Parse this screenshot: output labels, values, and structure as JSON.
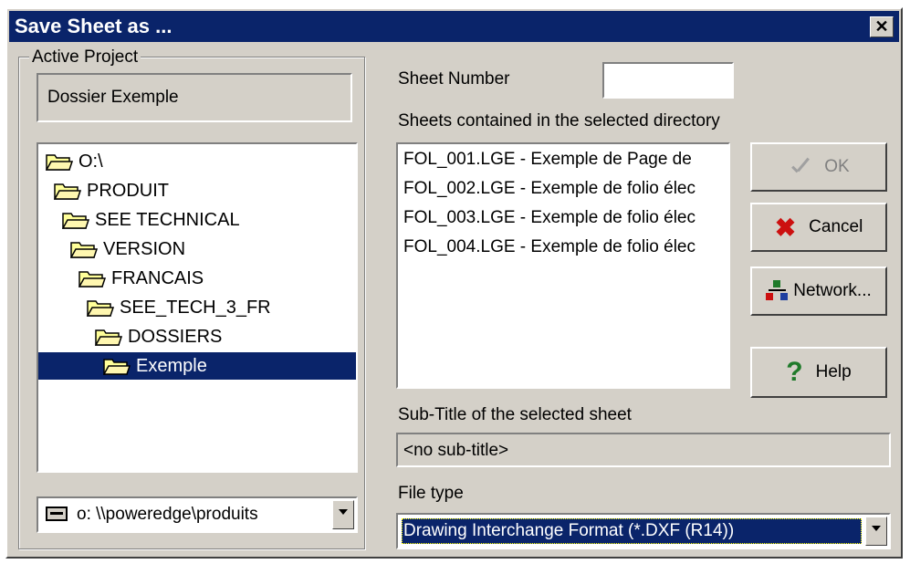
{
  "window": {
    "title": "Save Sheet as ...",
    "close_glyph": "✕"
  },
  "project": {
    "group_label": "Active Project",
    "name": "Dossier Exemple"
  },
  "tree": {
    "items": [
      {
        "label": "O:\\",
        "level": 0
      },
      {
        "label": "PRODUIT",
        "level": 1
      },
      {
        "label": "SEE TECHNICAL",
        "level": 2
      },
      {
        "label": "VERSION",
        "level": 3
      },
      {
        "label": "FRANCAIS",
        "level": 4
      },
      {
        "label": "SEE_TECH_3_FR",
        "level": 5
      },
      {
        "label": "DOSSIERS",
        "level": 6
      },
      {
        "label": "Exemple",
        "level": 7,
        "selected": true
      }
    ]
  },
  "drive": {
    "value": "o: \\\\poweredge\\produits",
    "icon": "network-drive-icon"
  },
  "sheet_number": {
    "label": "Sheet Number",
    "value": ""
  },
  "sheets": {
    "label": "Sheets contained in the selected directory",
    "items": [
      "FOL_001.LGE - Exemple de Page de",
      "FOL_002.LGE - Exemple de folio élec",
      "FOL_003.LGE - Exemple de folio élec",
      "FOL_004.LGE - Exemple de folio élec"
    ]
  },
  "buttons": {
    "ok": "OK",
    "cancel": "Cancel",
    "network": "Network...",
    "help": "Help"
  },
  "subtitle": {
    "label": "Sub-Title of the selected sheet",
    "value": "<no sub-title>"
  },
  "file_type": {
    "label": "File type",
    "value": "Drawing Interchange Format (*.DXF (R14))"
  },
  "colors": {
    "face": "#d4d0c8",
    "title_bar": "#0a246a",
    "selection": "#0a246a",
    "cancel_x": "#cc1010",
    "help_q": "#1f7a2a"
  }
}
